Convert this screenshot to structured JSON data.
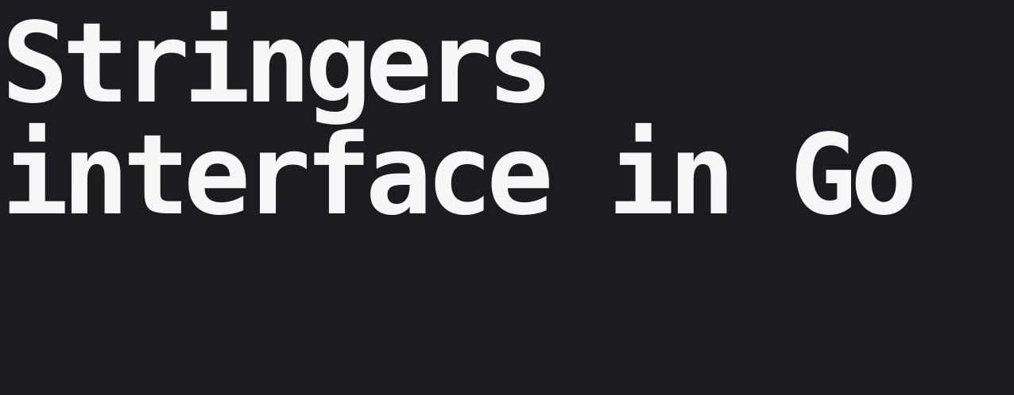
{
  "title": {
    "line1": "Stringers",
    "line2": "interface in Go"
  },
  "colors": {
    "background": "#1b1c21",
    "text": "#f7f7f7"
  }
}
